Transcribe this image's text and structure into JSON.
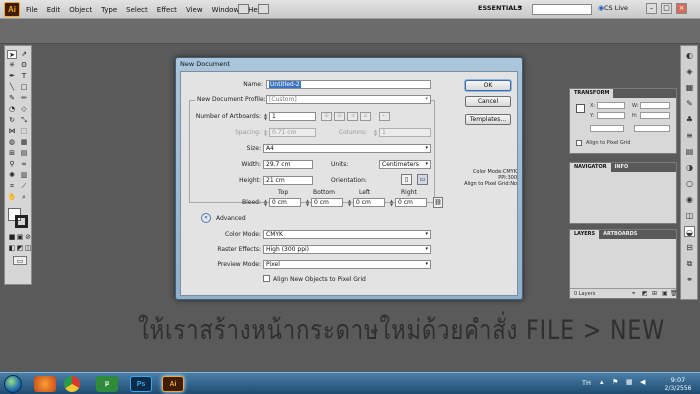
{
  "app": {
    "logo": "Ai",
    "menus": [
      "File",
      "Edit",
      "Object",
      "Type",
      "Select",
      "Effect",
      "View",
      "Window",
      "Help"
    ],
    "workspace": "ESSENTIALS",
    "cs_live": "CS Live"
  },
  "dialog": {
    "title": "New Document",
    "name_label": "Name:",
    "name_value": "Untitled-2",
    "profile_label": "New Document Profile:",
    "profile_value": "[Custom]",
    "artboards_label": "Number of Artboards:",
    "artboards_value": "1",
    "spacing_label": "Spacing:",
    "spacing_value": "0.71 cm",
    "columns_label": "Columns:",
    "columns_value": "1",
    "size_label": "Size:",
    "size_value": "A4",
    "width_label": "Width:",
    "width_value": "29.7 cm",
    "units_label": "Units:",
    "units_value": "Centimeters",
    "height_label": "Height:",
    "height_value": "21 cm",
    "orientation_label": "Orientation:",
    "bleed_label": "Bleed:",
    "bleed_headers": [
      "Top",
      "Bottom",
      "Left",
      "Right"
    ],
    "bleed_values": [
      "0 cm",
      "0 cm",
      "0 cm",
      "0 cm"
    ],
    "advanced_label": "Advanced",
    "color_mode_label": "Color Mode:",
    "color_mode_value": "CMYK",
    "raster_label": "Raster Effects:",
    "raster_value": "High (300 ppi)",
    "preview_label": "Preview Mode:",
    "preview_value": "Pixel",
    "align_checkbox_label": "Align New Objects to Pixel Grid",
    "ok_label": "OK",
    "cancel_label": "Cancel",
    "templates_label": "Templates...",
    "info_line1": "Color Mode:CMYK",
    "info_line2": "PPI:300",
    "info_line3": "Align to Pixel Grid:No"
  },
  "panels": {
    "transform_tab": "TRANSFORM",
    "x_label": "X:",
    "y_label": "Y:",
    "w_label": "W:",
    "h_label": "H:",
    "align_pixel_grid": "Align to Pixel Grid",
    "navigator_tab": "NAVIGATOR",
    "info_tab": "INFO",
    "layers_tab": "LAYERS",
    "artboards_tab": "ARTBOARDS",
    "layers_count": "0 Layers"
  },
  "caption": "ให้เราสร้างหน้ากระดาษใหม่ด้วยคำสั่ง FILE > NEW",
  "taskbar": {
    "apps": [
      "Firefox",
      "Chrome",
      "µTorrent",
      "Ps",
      "Ai"
    ],
    "lang": "TH",
    "time": "9:07",
    "date": "2/3/2556"
  }
}
